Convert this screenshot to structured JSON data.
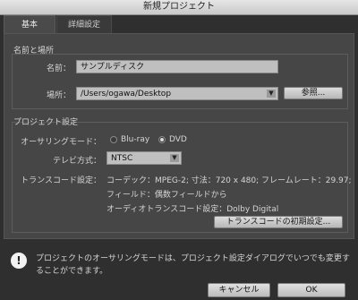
{
  "window": {
    "title": "新規プロジェクト"
  },
  "tabs": [
    {
      "label": "基本",
      "active": true
    },
    {
      "label": "詳細設定",
      "active": false
    }
  ],
  "name_location": {
    "title": "名前と場所",
    "name_label": "名前：",
    "name_value": "サンプルディスク",
    "location_label": "場所：",
    "location_value": "/Users/ogawa/Desktop",
    "browse_label": "参照..."
  },
  "project_settings": {
    "title": "プロジェクト設定",
    "authoring_label": "オーサリングモード：",
    "authoring_options": [
      "Blu-ray",
      "DVD"
    ],
    "authoring_selected": "DVD",
    "tv_label": "テレビ方式：",
    "tv_value": "NTSC",
    "transcode_label": "トランスコード設定：",
    "transcode_lines": [
      "コーデック：MPEG-2; 寸法：720 x 480; フレームレート：29.97;",
      "フィールド：偶数フィールドから",
      "オーディオトランスコード設定：Dolby Digital"
    ],
    "transcode_defaults_label": "トランスコードの初期設定..."
  },
  "info": {
    "icon": "info-icon",
    "text": "プロジェクトのオーサリングモードは、プロジェクト設定ダイアログでいつでも変更することができます。"
  },
  "footer": {
    "cancel_label": "キャンセル",
    "ok_label": "OK"
  }
}
